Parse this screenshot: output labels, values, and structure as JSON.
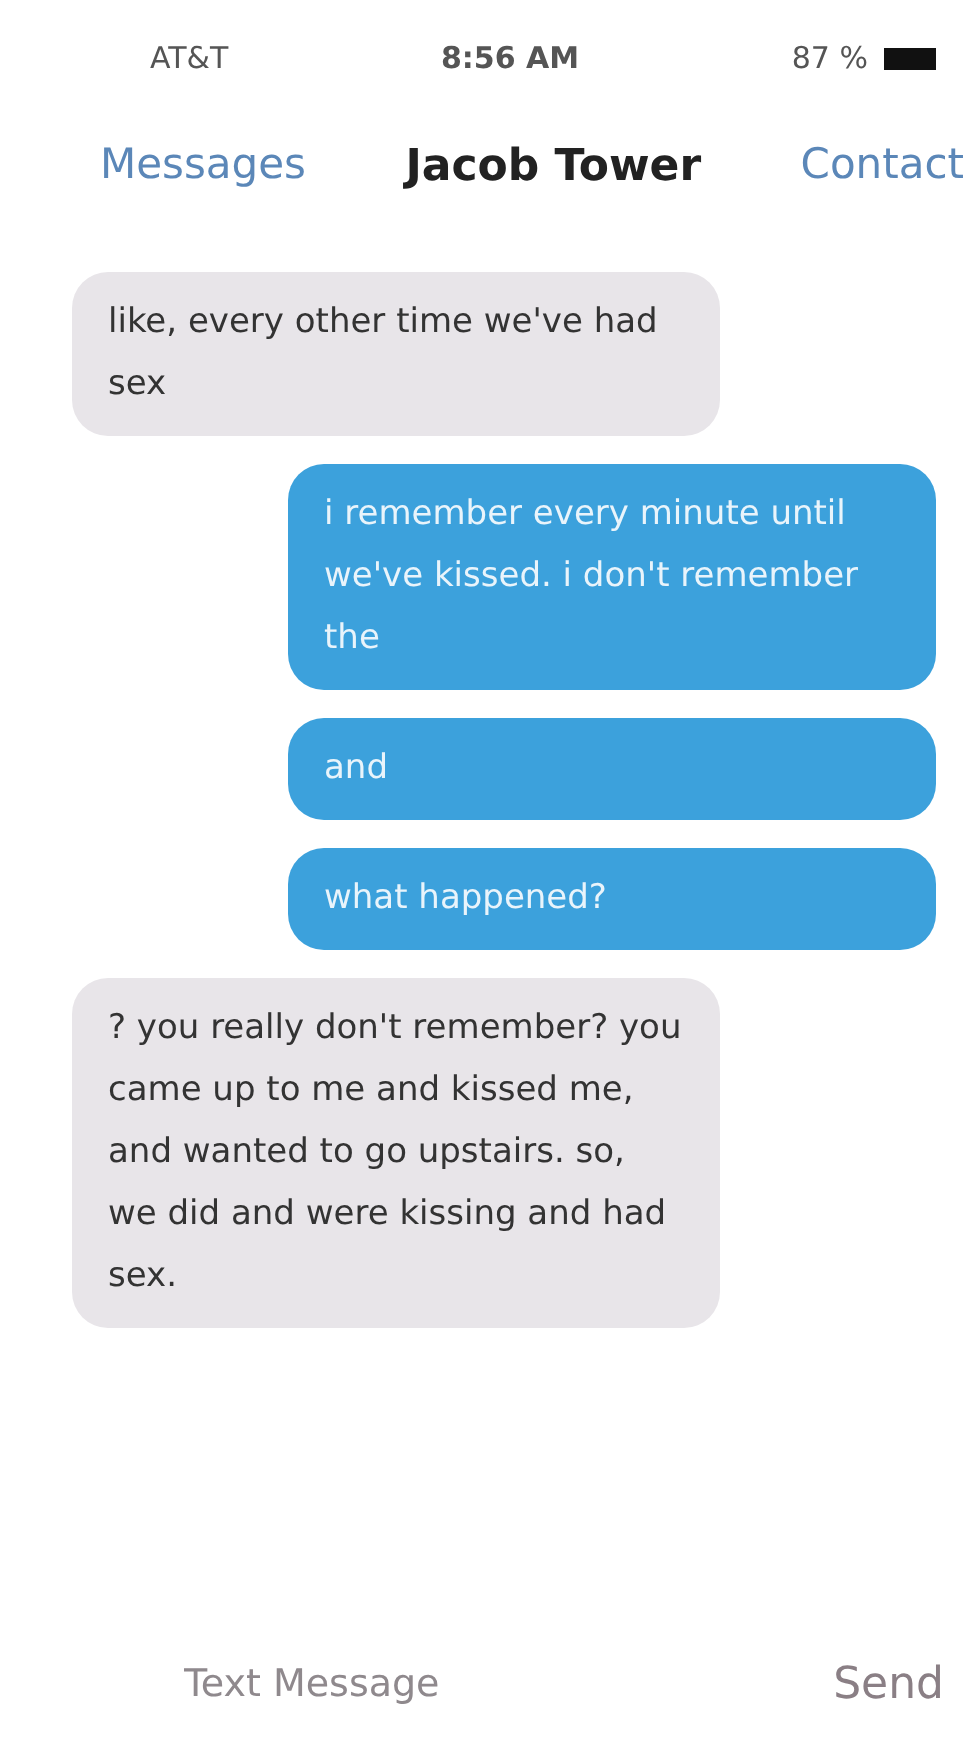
{
  "status_bar": {
    "carrier": "AT&T",
    "time": "8:56 AM",
    "battery": "87 %"
  },
  "nav": {
    "back": "Messages",
    "title": "Jacob Tower",
    "action": "Contact"
  },
  "messages": [
    {
      "kind": "received",
      "text": "like, every other time we've had sex"
    },
    {
      "kind": "sent",
      "text": "i remember every minute until we've kissed. i don't remember the"
    },
    {
      "kind": "sent",
      "text": "and"
    },
    {
      "kind": "sent",
      "text": "what happened?"
    },
    {
      "kind": "received",
      "text": "? you really don't remember? you came up to me and kissed me, and wanted to go upstairs. so, we did and were kissing and had sex."
    }
  ],
  "composer": {
    "placeholder": "Text Message",
    "send": "Send"
  }
}
